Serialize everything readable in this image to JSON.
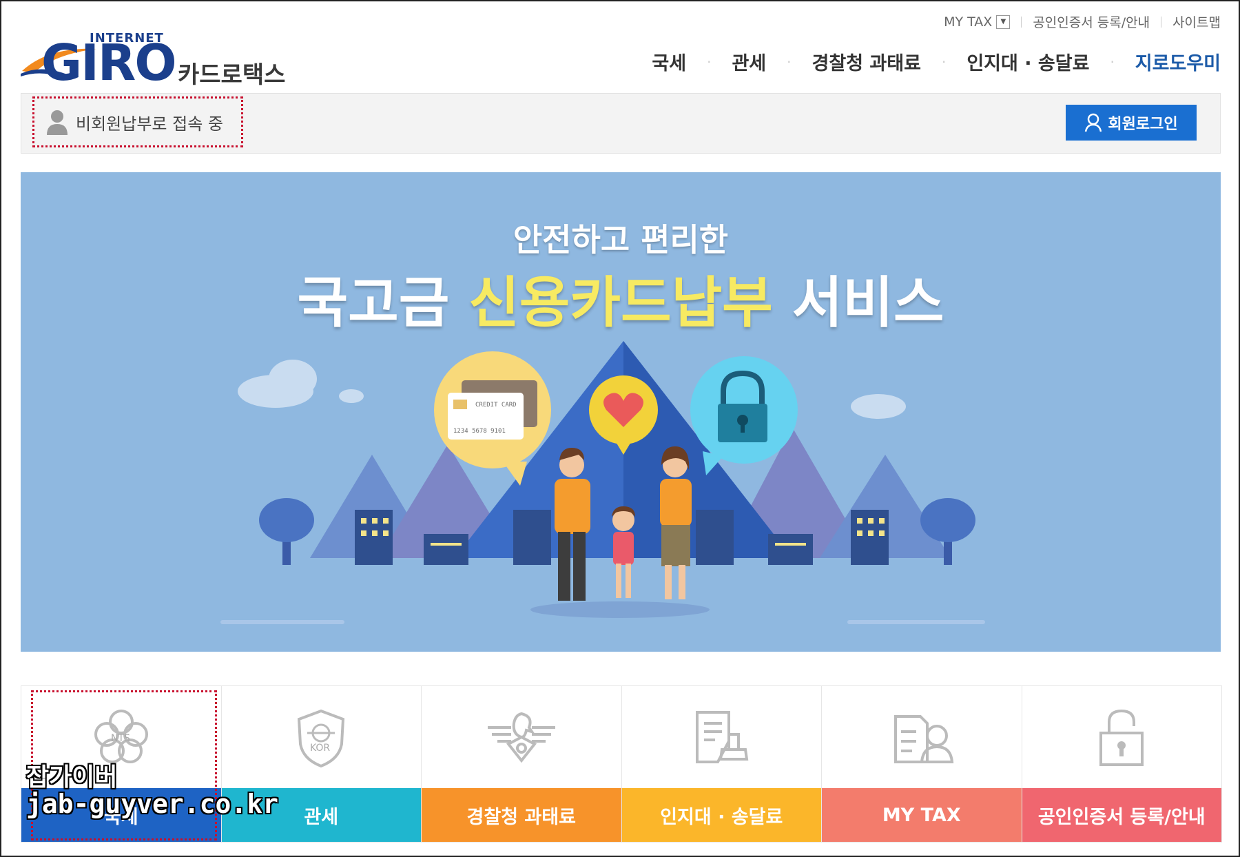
{
  "header": {
    "logo_top": "INTERNET",
    "logo_main": "GIRO",
    "logo_sub": "카드로택스",
    "util": {
      "mytax": "MY TAX",
      "cert": "공인인증서 등록/안내",
      "sitemap": "사이트맵"
    },
    "nav": [
      {
        "label": "국세"
      },
      {
        "label": "관세"
      },
      {
        "label": "경찰청 과태료"
      },
      {
        "label": "인지대 · 송달료"
      },
      {
        "label": "지로도우미"
      }
    ]
  },
  "status": {
    "text": "비회원납부로 접속 중",
    "login_label": "회원로그인"
  },
  "banner": {
    "subtitle": "안전하고 편리한",
    "title_a": "국고금",
    "title_hl": "신용카드납부",
    "title_b": "서비스",
    "card_text": "CREDIT CARD",
    "card_number": "1234 5678 9101"
  },
  "tiles": [
    {
      "label": "국세",
      "icon": "nts-emblem-icon",
      "emblem": "NTS",
      "color": "#1e63c4"
    },
    {
      "label": "관세",
      "icon": "customs-shield-icon",
      "emblem": "KOR",
      "color": "#1fb6cf"
    },
    {
      "label": "경찰청 과태료",
      "icon": "police-eagle-icon",
      "color": "#f7932a"
    },
    {
      "label": "인지대 · 송달료",
      "icon": "stamp-document-icon",
      "color": "#fbb62a"
    },
    {
      "label": "MY TAX",
      "icon": "user-document-icon",
      "color": "#f37c6c"
    },
    {
      "label": "공인인증서 등록/안내",
      "icon": "unlock-icon",
      "color": "#f0666f"
    }
  ],
  "watermark": {
    "line1": "잡가이버",
    "line2": "jab-guyver.co.kr"
  }
}
